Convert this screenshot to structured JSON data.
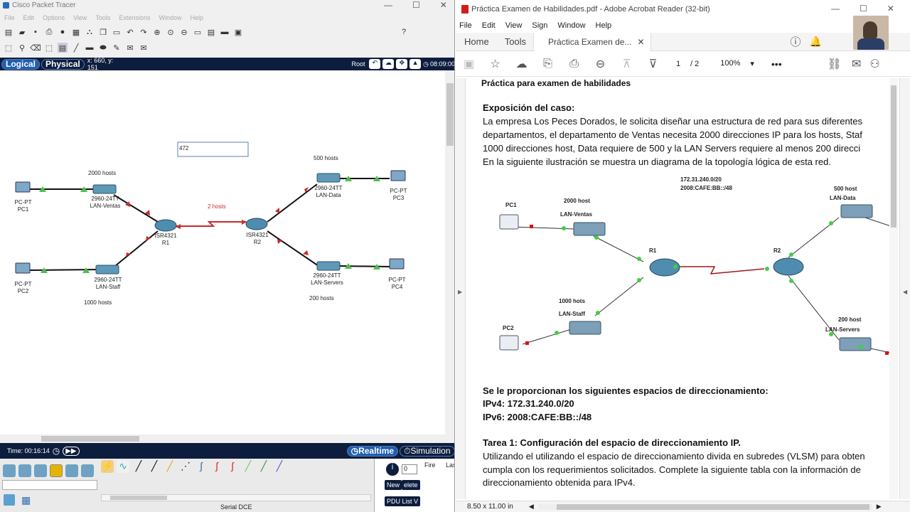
{
  "pt": {
    "title": "Cisco Packet Tracer",
    "menu": [
      "File",
      "Edit",
      "Options",
      "View",
      "Tools",
      "Extensions",
      "Window",
      "Help"
    ],
    "mode_logical": "Logical",
    "mode_physical": "Physical",
    "coords": "x: 660, y: 151",
    "root": "Root",
    "clock": "08:09:00",
    "note_text": "472",
    "devices": {
      "pc1": [
        "PC-PT",
        "PC1"
      ],
      "pc2": [
        "PC-PT",
        "PC2"
      ],
      "pc3": [
        "PC-PT",
        "PC3"
      ],
      "pc4": [
        "PC-PT",
        "PC4"
      ],
      "sw_ventas": [
        "2960-24TT",
        "LAN-Ventas"
      ],
      "sw_staff": [
        "2960-24TT",
        "LAN-Staff"
      ],
      "sw_data": [
        "2960-24TT",
        "LAN-Data"
      ],
      "sw_servers": [
        "2960-24TT",
        "LAN-Servers"
      ],
      "r1": [
        "ISR4321",
        "R1"
      ],
      "r2": [
        "ISR4321",
        "R2"
      ]
    },
    "hosts": {
      "ventas": "2000 hosts",
      "staff": "1000 hosts",
      "data": "500 hosts",
      "servers": "200 hosts",
      "wan": "2 hosts"
    },
    "time": "Time: 00:16:14",
    "realtime": "Realtime",
    "simulation": "Simulation",
    "cable_name": "Serial DCE",
    "pdu_select": "0",
    "btn_new": "New",
    "btn_delete": "elete",
    "btn_pdu": "PDU List V",
    "col_fire": "Fire",
    "col_last": "Las"
  },
  "ar": {
    "title": "Práctica Examen de Habilidades.pdf - Adobe Acrobat Reader (32-bit)",
    "menu": [
      "File",
      "Edit",
      "View",
      "Sign",
      "Window",
      "Help"
    ],
    "tab_home": "Home",
    "tab_tools": "Tools",
    "tab_doc": "Práctica Examen de...",
    "page_current": "1",
    "page_total": "/ 2",
    "zoom": "100%",
    "page_size": "8.50 x 11.00 in",
    "doc": {
      "heading": "Práctica para examen de habilidades",
      "section": "Exposición del caso:",
      "p1": "La empresa Los Peces Dorados, le solicita diseñar una estructura de red para sus diferentes",
      "p2": "departamentos, el departamento de Ventas necesita 2000 direcciones IP para los hosts, Staf",
      "p3": "1000 direcciones host, Data requiere de 500 y la LAN Servers requiere al menos 200 direcci",
      "p4": "En la siguiente ilustración se muestra un diagrama de la topología lógica de esta red.",
      "diag_net4": "172.31.240.0/20",
      "diag_net6": "2008:CAFE:BB::/48",
      "diag_pc1": "PC1",
      "diag_pc2": "PC2",
      "diag_r1": "R1",
      "diag_r2": "R2",
      "diag_ventas_h": "2000 host",
      "diag_ventas": "LAN-Ventas",
      "diag_staff_h": "1000 hots",
      "diag_staff": "LAN-Staff",
      "diag_data_h": "500 host",
      "diag_data": "LAN-Data",
      "diag_servers_h": "200 host",
      "diag_servers": "LAN-Servers",
      "s2": "Se le proporcionan los siguientes espacios de direccionamiento:",
      "ipv4": "IPv4: 172.31.240.0/20",
      "ipv6": "IPv6: 2008:CAFE:BB::/48",
      "t1": "Tarea 1: Configuración del espacio de direccionamiento IP.",
      "t1p1": "Utilizando el utilizando el espacio de direccionamiento divida en subredes (VLSM) para obten",
      "t1p2": "cumpla con los requerimientos solicitados. Complete la siguiente tabla con la información de",
      "t1p3": "direccionamiento obtenida para IPv4."
    }
  }
}
